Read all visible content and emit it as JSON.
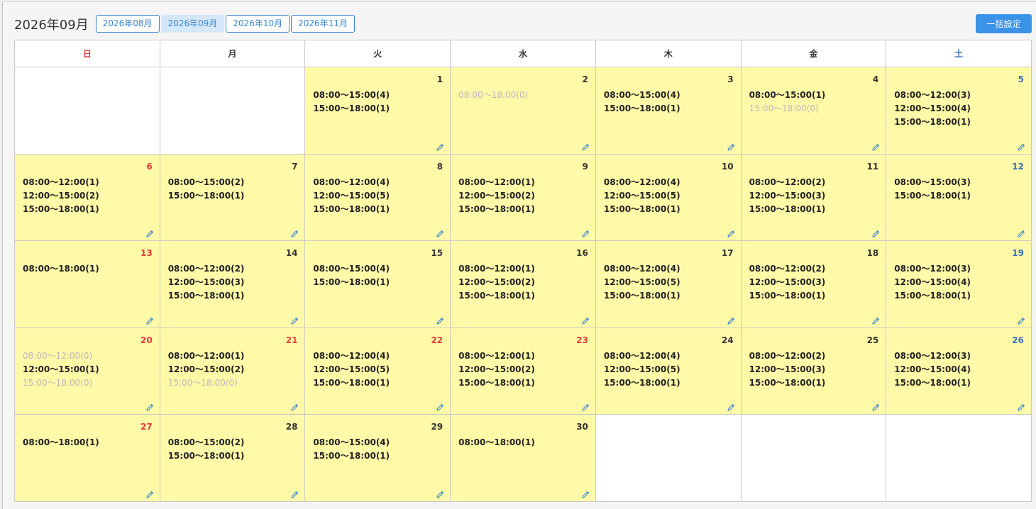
{
  "header": {
    "month_title": "2026年09月",
    "month_buttons": [
      "2026年08月",
      "2026年09月",
      "2026年10月",
      "2026年11月"
    ],
    "active_month_index": 1,
    "bulk_label": "一括設定"
  },
  "weekdays": [
    "日",
    "月",
    "火",
    "水",
    "木",
    "金",
    "土"
  ],
  "colors": {
    "accent": "#3a93e6",
    "cell_bg": "#fffaa8",
    "sunday": "#e23b3b",
    "saturday": "#3a6fb8",
    "disabled_text": "#b8b8b8"
  },
  "days": [
    {
      "day": "1",
      "weekday": 2,
      "holiday": false,
      "slots": [
        {
          "t": "08:00～15:00(4)",
          "zero": false
        },
        {
          "t": "15:00～18:00(1)",
          "zero": false
        }
      ]
    },
    {
      "day": "2",
      "weekday": 3,
      "holiday": false,
      "slots": [
        {
          "t": "08:00～18:00(0)",
          "zero": true
        }
      ]
    },
    {
      "day": "3",
      "weekday": 4,
      "holiday": false,
      "slots": [
        {
          "t": "08:00～15:00(4)",
          "zero": false
        },
        {
          "t": "15:00～18:00(1)",
          "zero": false
        }
      ]
    },
    {
      "day": "4",
      "weekday": 5,
      "holiday": false,
      "slots": [
        {
          "t": "08:00～15:00(1)",
          "zero": false
        },
        {
          "t": "15:00～18:00(0)",
          "zero": true
        }
      ]
    },
    {
      "day": "5",
      "weekday": 6,
      "holiday": false,
      "slots": [
        {
          "t": "08:00～12:00(3)",
          "zero": false
        },
        {
          "t": "12:00～15:00(4)",
          "zero": false
        },
        {
          "t": "15:00～18:00(1)",
          "zero": false
        }
      ]
    },
    {
      "day": "6",
      "weekday": 0,
      "holiday": false,
      "slots": [
        {
          "t": "08:00～12:00(1)",
          "zero": false
        },
        {
          "t": "12:00～15:00(2)",
          "zero": false
        },
        {
          "t": "15:00～18:00(1)",
          "zero": false
        }
      ]
    },
    {
      "day": "7",
      "weekday": 1,
      "holiday": false,
      "slots": [
        {
          "t": "08:00～15:00(2)",
          "zero": false
        },
        {
          "t": "15:00～18:00(1)",
          "zero": false
        }
      ]
    },
    {
      "day": "8",
      "weekday": 2,
      "holiday": false,
      "slots": [
        {
          "t": "08:00～12:00(4)",
          "zero": false
        },
        {
          "t": "12:00～15:00(5)",
          "zero": false
        },
        {
          "t": "15:00～18:00(1)",
          "zero": false
        }
      ]
    },
    {
      "day": "9",
      "weekday": 3,
      "holiday": false,
      "slots": [
        {
          "t": "08:00～12:00(1)",
          "zero": false
        },
        {
          "t": "12:00～15:00(2)",
          "zero": false
        },
        {
          "t": "15:00～18:00(1)",
          "zero": false
        }
      ]
    },
    {
      "day": "10",
      "weekday": 4,
      "holiday": false,
      "slots": [
        {
          "t": "08:00～12:00(4)",
          "zero": false
        },
        {
          "t": "12:00～15:00(5)",
          "zero": false
        },
        {
          "t": "15:00～18:00(1)",
          "zero": false
        }
      ]
    },
    {
      "day": "11",
      "weekday": 5,
      "holiday": false,
      "slots": [
        {
          "t": "08:00～12:00(2)",
          "zero": false
        },
        {
          "t": "12:00～15:00(3)",
          "zero": false
        },
        {
          "t": "15:00～18:00(1)",
          "zero": false
        }
      ]
    },
    {
      "day": "12",
      "weekday": 6,
      "holiday": false,
      "slots": [
        {
          "t": "08:00～15:00(3)",
          "zero": false
        },
        {
          "t": "15:00～18:00(1)",
          "zero": false
        }
      ]
    },
    {
      "day": "13",
      "weekday": 0,
      "holiday": false,
      "slots": [
        {
          "t": "08:00～18:00(1)",
          "zero": false
        }
      ]
    },
    {
      "day": "14",
      "weekday": 1,
      "holiday": false,
      "slots": [
        {
          "t": "08:00～12:00(2)",
          "zero": false
        },
        {
          "t": "12:00～15:00(3)",
          "zero": false
        },
        {
          "t": "15:00～18:00(1)",
          "zero": false
        }
      ]
    },
    {
      "day": "15",
      "weekday": 2,
      "holiday": false,
      "slots": [
        {
          "t": "08:00～15:00(4)",
          "zero": false
        },
        {
          "t": "15:00～18:00(1)",
          "zero": false
        }
      ]
    },
    {
      "day": "16",
      "weekday": 3,
      "holiday": false,
      "slots": [
        {
          "t": "08:00～12:00(1)",
          "zero": false
        },
        {
          "t": "12:00～15:00(2)",
          "zero": false
        },
        {
          "t": "15:00～18:00(1)",
          "zero": false
        }
      ]
    },
    {
      "day": "17",
      "weekday": 4,
      "holiday": false,
      "slots": [
        {
          "t": "08:00～12:00(4)",
          "zero": false
        },
        {
          "t": "12:00～15:00(5)",
          "zero": false
        },
        {
          "t": "15:00～18:00(1)",
          "zero": false
        }
      ]
    },
    {
      "day": "18",
      "weekday": 5,
      "holiday": false,
      "slots": [
        {
          "t": "08:00～12:00(2)",
          "zero": false
        },
        {
          "t": "12:00～15:00(3)",
          "zero": false
        },
        {
          "t": "15:00～18:00(1)",
          "zero": false
        }
      ]
    },
    {
      "day": "19",
      "weekday": 6,
      "holiday": false,
      "slots": [
        {
          "t": "08:00～12:00(3)",
          "zero": false
        },
        {
          "t": "12:00～15:00(4)",
          "zero": false
        },
        {
          "t": "15:00～18:00(1)",
          "zero": false
        }
      ]
    },
    {
      "day": "20",
      "weekday": 0,
      "holiday": false,
      "slots": [
        {
          "t": "08:00～12:00(0)",
          "zero": true
        },
        {
          "t": "12:00～15:00(1)",
          "zero": false
        },
        {
          "t": "15:00～18:00(0)",
          "zero": true
        }
      ]
    },
    {
      "day": "21",
      "weekday": 1,
      "holiday": true,
      "slots": [
        {
          "t": "08:00～12:00(1)",
          "zero": false
        },
        {
          "t": "12:00～15:00(2)",
          "zero": false
        },
        {
          "t": "15:00～18:00(0)",
          "zero": true
        }
      ]
    },
    {
      "day": "22",
      "weekday": 2,
      "holiday": true,
      "slots": [
        {
          "t": "08:00～12:00(4)",
          "zero": false
        },
        {
          "t": "12:00～15:00(5)",
          "zero": false
        },
        {
          "t": "15:00～18:00(1)",
          "zero": false
        }
      ]
    },
    {
      "day": "23",
      "weekday": 3,
      "holiday": true,
      "slots": [
        {
          "t": "08:00～12:00(1)",
          "zero": false
        },
        {
          "t": "12:00～15:00(2)",
          "zero": false
        },
        {
          "t": "15:00～18:00(1)",
          "zero": false
        }
      ]
    },
    {
      "day": "24",
      "weekday": 4,
      "holiday": false,
      "slots": [
        {
          "t": "08:00～12:00(4)",
          "zero": false
        },
        {
          "t": "12:00～15:00(5)",
          "zero": false
        },
        {
          "t": "15:00～18:00(1)",
          "zero": false
        }
      ]
    },
    {
      "day": "25",
      "weekday": 5,
      "holiday": false,
      "slots": [
        {
          "t": "08:00～12:00(2)",
          "zero": false
        },
        {
          "t": "12:00～15:00(3)",
          "zero": false
        },
        {
          "t": "15:00～18:00(1)",
          "zero": false
        }
      ]
    },
    {
      "day": "26",
      "weekday": 6,
      "holiday": false,
      "slots": [
        {
          "t": "08:00～12:00(3)",
          "zero": false
        },
        {
          "t": "12:00～15:00(4)",
          "zero": false
        },
        {
          "t": "15:00～18:00(1)",
          "zero": false
        }
      ]
    },
    {
      "day": "27",
      "weekday": 0,
      "holiday": false,
      "slots": [
        {
          "t": "08:00～18:00(1)",
          "zero": false
        }
      ]
    },
    {
      "day": "28",
      "weekday": 1,
      "holiday": false,
      "slots": [
        {
          "t": "08:00～15:00(2)",
          "zero": false
        },
        {
          "t": "15:00～18:00(1)",
          "zero": false
        }
      ]
    },
    {
      "day": "29",
      "weekday": 2,
      "holiday": false,
      "slots": [
        {
          "t": "08:00～15:00(4)",
          "zero": false
        },
        {
          "t": "15:00～18:00(1)",
          "zero": false
        }
      ]
    },
    {
      "day": "30",
      "weekday": 3,
      "holiday": false,
      "slots": [
        {
          "t": "08:00～18:00(1)",
          "zero": false
        }
      ]
    }
  ]
}
